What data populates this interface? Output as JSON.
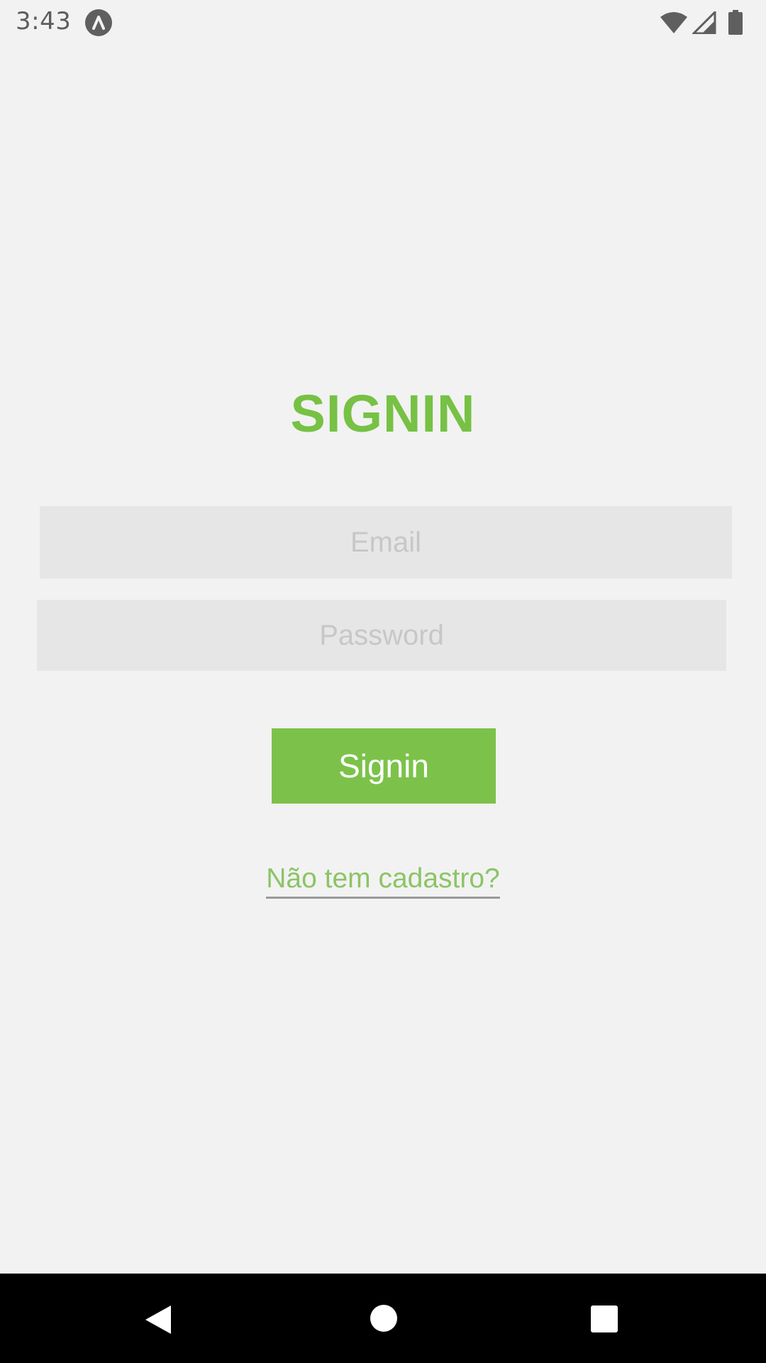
{
  "status_bar": {
    "time": "3:43",
    "app_icon": "a-circle-icon",
    "right_icons": [
      "wifi-icon",
      "signal-icon",
      "battery-icon"
    ]
  },
  "login": {
    "title": "SIGNIN",
    "email_placeholder": "Email",
    "password_placeholder": "Password",
    "signin_button": "Signin",
    "register_link": "Não tem cadastro?"
  },
  "nav_bar": {
    "icons": [
      "back-icon",
      "home-icon",
      "recents-icon"
    ]
  },
  "colors": {
    "accent": "#7cc24a",
    "background": "#f2f2f2",
    "input_background": "#e6e6e6"
  }
}
